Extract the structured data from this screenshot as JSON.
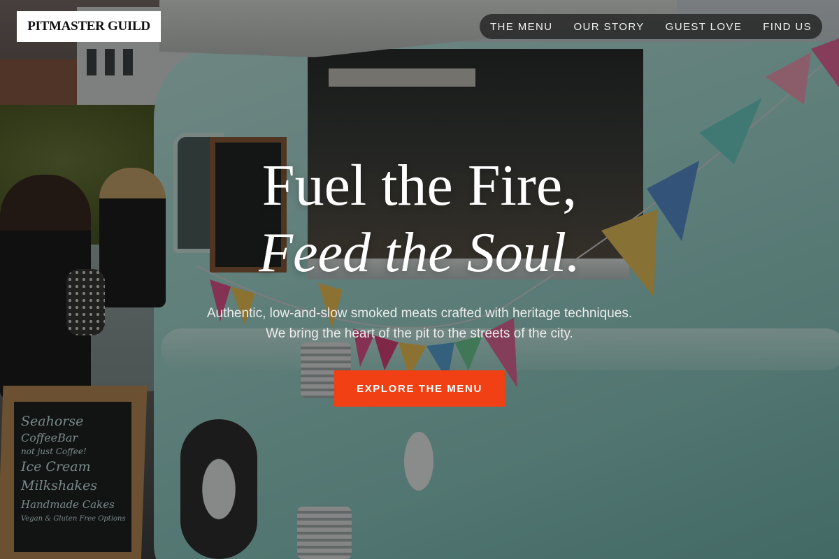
{
  "brand": {
    "logo_text": "PITMASTER GUILD"
  },
  "nav": {
    "items": [
      {
        "label": "THE MENU"
      },
      {
        "label": "OUR STORY"
      },
      {
        "label": "GUEST LOVE"
      },
      {
        "label": "FIND US"
      }
    ]
  },
  "hero": {
    "title_line1": "Fuel the Fire,",
    "title_line2": "Feed the Soul.",
    "subtitle": "Authentic, low-and-slow smoked meats crafted with heritage techniques. We bring the heart of the pit to the streets of the city.",
    "cta_label": "EXPLORE THE MENU"
  },
  "background": {
    "description_icon": "food-truck-photo",
    "chalkboard_lines": [
      "Seahorse",
      "CoffeeBar",
      "not just Coffee!",
      "Ice Cream",
      "Milkshakes",
      "Handmade Cakes",
      "Vegan & Gluten Free Options"
    ]
  },
  "colors": {
    "accent": "#f04014",
    "nav_bg": "#191919",
    "logo_bg": "#ffffff",
    "text": "#ffffff"
  }
}
